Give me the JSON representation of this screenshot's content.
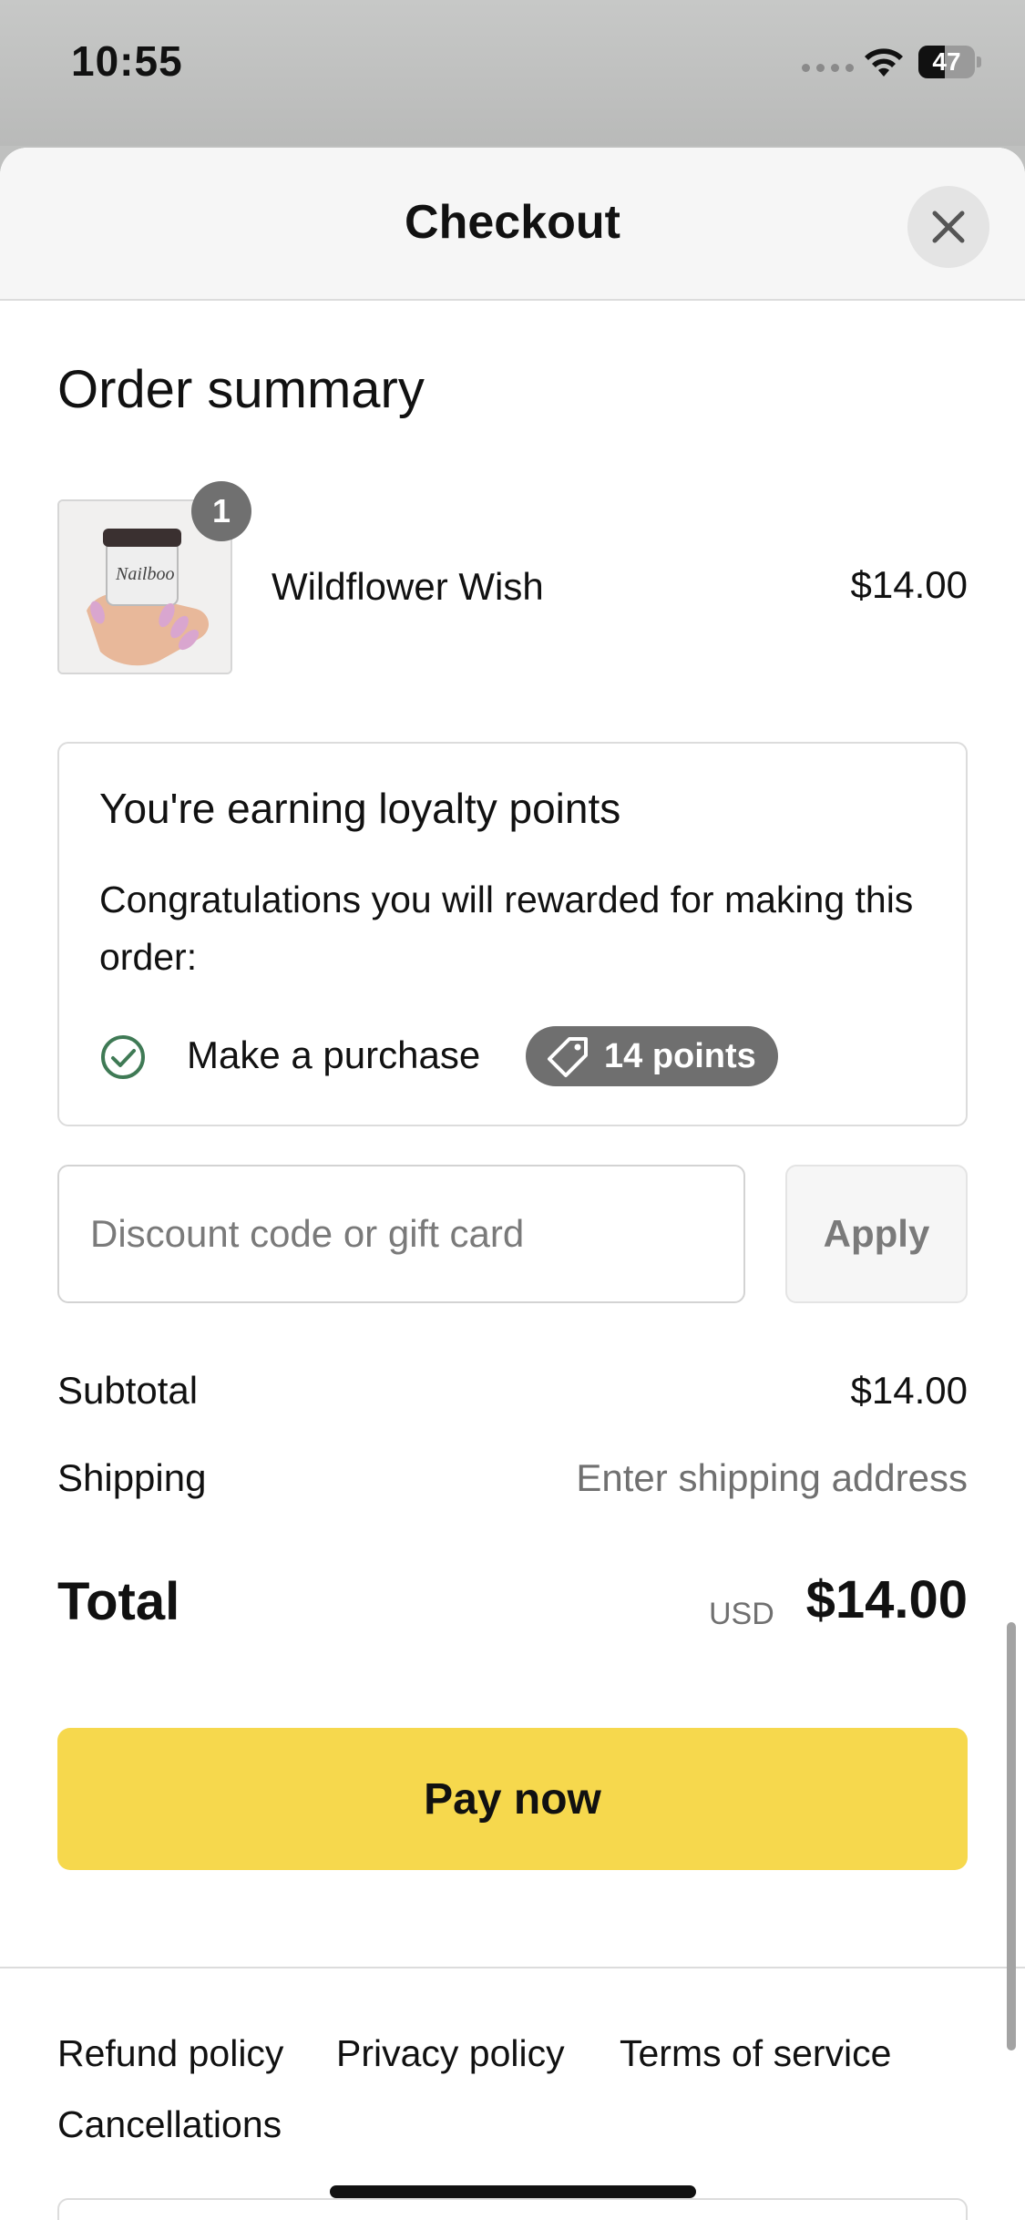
{
  "status_bar": {
    "time": "10:55",
    "battery": "47",
    "battery_level": 0.47
  },
  "sheet": {
    "title": "Checkout"
  },
  "order_summary": {
    "heading": "Order summary",
    "items": [
      {
        "name": "Wildflower Wish",
        "price": "$14.00",
        "quantity": "1",
        "thumb_brand": "Nailboo"
      }
    ]
  },
  "loyalty": {
    "title": "You're earning loyalty points",
    "message": "Congratulations you will rewarded for making this order:",
    "action_label": "Make a purchase",
    "points_label": "14 points"
  },
  "discount": {
    "placeholder": "Discount code or gift card",
    "apply_label": "Apply"
  },
  "totals": {
    "subtotal_label": "Subtotal",
    "subtotal_value": "$14.00",
    "shipping_label": "Shipping",
    "shipping_value": "Enter shipping address",
    "total_label": "Total",
    "currency": "USD",
    "total_value": "$14.00"
  },
  "pay_button_label": "Pay now",
  "footer": {
    "links": [
      "Refund policy",
      "Privacy policy",
      "Terms of service",
      "Cancellations"
    ]
  },
  "colors": {
    "pay_button": "#f6d84d",
    "pill": "#6f6f6f",
    "check_green": "#3f7a55"
  },
  "icons": [
    "close-icon",
    "check-circle-icon",
    "tag-icon",
    "wifi-icon",
    "battery-icon"
  ]
}
